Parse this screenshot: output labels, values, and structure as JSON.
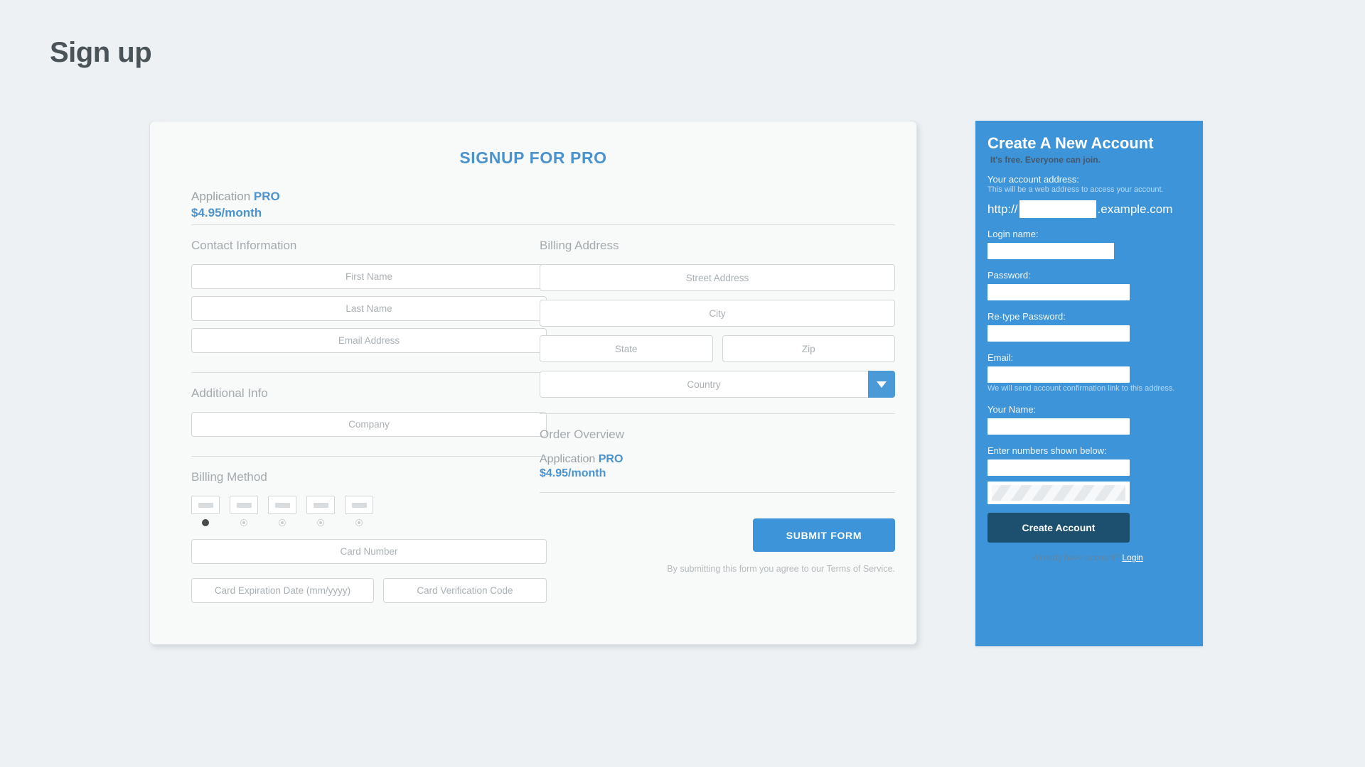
{
  "page": {
    "title": "Sign up"
  },
  "signup_card": {
    "heading": "SIGNUP FOR PRO",
    "plan": {
      "label": "Application",
      "tier": "PRO",
      "price": "$4.95/month"
    },
    "contact": {
      "section_title": "Contact Information",
      "fields": [
        {
          "name": "first-name",
          "placeholder": "First Name"
        },
        {
          "name": "last-name",
          "placeholder": "Last Name"
        },
        {
          "name": "email-address",
          "placeholder": "Email Address"
        }
      ]
    },
    "additional": {
      "section_title": "Additional Info",
      "fields": [
        {
          "name": "company",
          "placeholder": "Company"
        }
      ]
    },
    "billing_method": {
      "section_title": "Billing Method",
      "options": [
        {
          "name": "card-brand-1",
          "selected": true
        },
        {
          "name": "card-brand-2",
          "selected": false
        },
        {
          "name": "card-brand-3",
          "selected": false
        },
        {
          "name": "card-brand-4",
          "selected": false
        },
        {
          "name": "card-brand-5",
          "selected": false
        }
      ],
      "card_number_placeholder": "Card Number",
      "card_expiration_placeholder": "Card Expiration Date (mm/yyyy)",
      "card_cvc_placeholder": "Card Verification Code"
    },
    "billing_address": {
      "section_title": "Billing Address",
      "street_placeholder": "Street Address",
      "city_placeholder": "City",
      "state_placeholder": "State",
      "zip_placeholder": "Zip",
      "country_placeholder": "Country",
      "country_selected": "Country"
    },
    "order_overview": {
      "section_title": "Order Overview",
      "label": "Application",
      "tier": "PRO",
      "price": "$4.95/month"
    },
    "submit_label": "SUBMIT FORM",
    "terms_text": "By submitting this form you agree to our Terms of Service."
  },
  "account_panel": {
    "title": "Create A New Account",
    "subtitle": "It's free. Everyone can join.",
    "address_label": "Your account address:",
    "address_hint": "This will be a web address to access your account.",
    "url_prefix": "http://",
    "url_suffix": ".example.com",
    "url_value": "",
    "login_name_label": "Login name:",
    "password_label": "Password:",
    "retype_password_label": "Re-type Password:",
    "email_label": "Email:",
    "email_hint": "We will send account confirmation link to this address.",
    "your_name_label": "Your Name:",
    "captcha_label": "Enter numbers shown below:",
    "create_button": "Create Account",
    "footer_text": "Already have account?",
    "footer_link": "Login",
    "footer_period": "."
  },
  "colors": {
    "page_bg": "#edf1f4",
    "accent_blue": "#3d94d9",
    "heading_blue": "#4a93cf",
    "dark_blue_button": "#1d506f",
    "card_bg": "#f8f9f9",
    "title_gray": "#4a5358",
    "muted_gray": "#a4abaf"
  }
}
